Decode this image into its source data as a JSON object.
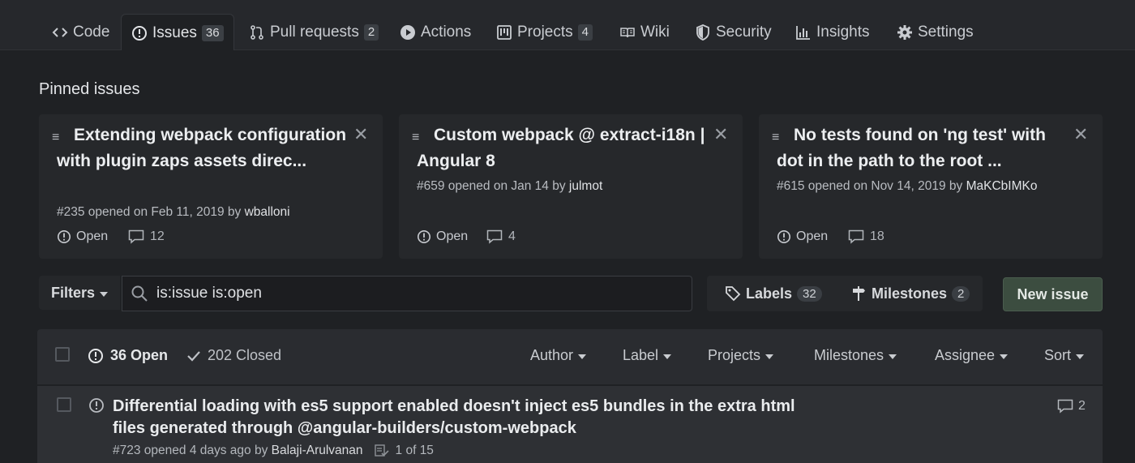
{
  "nav": {
    "tabs": [
      {
        "label": "Code",
        "icon": "code-icon"
      },
      {
        "label": "Issues",
        "count": "36",
        "icon": "issue-opened-icon",
        "active": true
      },
      {
        "label": "Pull requests",
        "count": "2",
        "icon": "git-pull-request-icon"
      },
      {
        "label": "Actions",
        "icon": "play-icon"
      },
      {
        "label": "Projects",
        "count": "4",
        "icon": "project-icon"
      },
      {
        "label": "Wiki",
        "icon": "book-icon"
      },
      {
        "label": "Security",
        "icon": "shield-icon"
      },
      {
        "label": "Insights",
        "icon": "graph-icon"
      },
      {
        "label": "Settings",
        "icon": "gear-icon"
      }
    ]
  },
  "pinned": {
    "heading": "Pinned issues",
    "cards": [
      {
        "title": "Extending webpack configuration with plugin zaps assets direc...",
        "number": "#235",
        "opened_text": "opened on Feb 11, 2019 by",
        "author": "wballoni",
        "status": "Open",
        "comments": "12"
      },
      {
        "title": "Custom webpack @ extract-i18n | Angular 8",
        "number": "#659",
        "opened_text": "opened on Jan 14 by",
        "author": "julmot",
        "status": "Open",
        "comments": "4"
      },
      {
        "title": "No tests found on 'ng test' with dot in the path to the root ...",
        "number": "#615",
        "opened_text": "opened on Nov 14, 2019 by",
        "author": "MaKCbIMKo",
        "status": "Open",
        "comments": "18"
      }
    ]
  },
  "toolbar": {
    "filters_label": "Filters",
    "search_value": "is:issue is:open",
    "labels_label": "Labels",
    "labels_count": "32",
    "milestones_label": "Milestones",
    "milestones_count": "2",
    "new_issue_label": "New issue"
  },
  "list_header": {
    "open_label": "36 Open",
    "closed_label": "202 Closed",
    "filters": [
      "Author",
      "Label",
      "Projects",
      "Milestones",
      "Assignee",
      "Sort"
    ]
  },
  "issues": [
    {
      "title": "Differential loading with es5 support enabled doesn't inject es5 bundles in the extra html files generated through @angular-builders/custom-webpack",
      "number": "#723",
      "opened_text": "opened 4 days ago by",
      "author": "Balaji-Arulvanan",
      "tasks": "1 of 15",
      "comments": "2"
    }
  ],
  "colors": {
    "background": "#1f2124",
    "nav_background": "#26282c",
    "card_background": "#26282b",
    "new_issue_button": "#3c4d40"
  }
}
